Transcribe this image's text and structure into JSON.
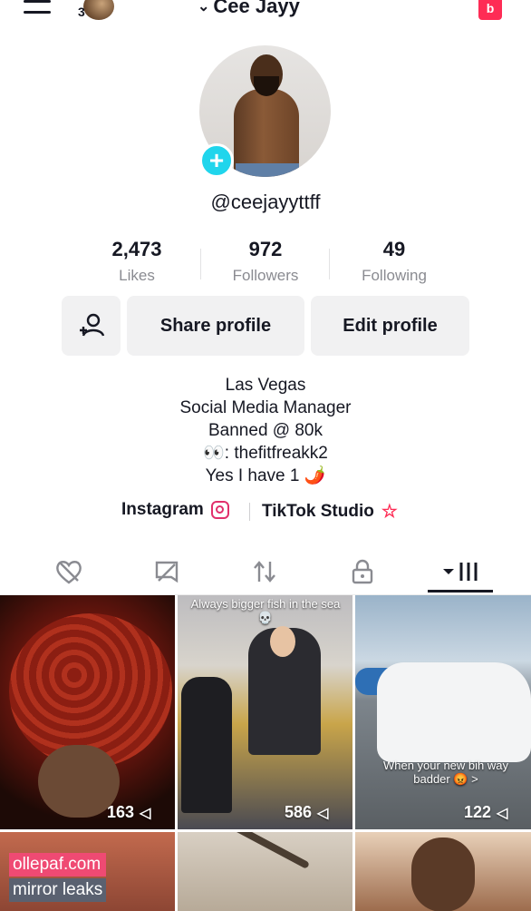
{
  "header": {
    "username": "Cee Jayy",
    "friends_count": "3",
    "inbox_badge": "b"
  },
  "profile": {
    "handle": "@ceejayyttff",
    "stats": [
      {
        "value": "49",
        "label": "Following"
      },
      {
        "value": "972",
        "label": "Followers"
      },
      {
        "value": "2,473",
        "label": "Likes"
      }
    ]
  },
  "actions": {
    "edit_label": "Edit profile",
    "share_label": "Share profile"
  },
  "bio": {
    "lines": [
      "Las Vegas",
      "Social Media Manager",
      "Banned @ 80k",
      "👀: thefitfreakk2",
      "Yes I have 1 🌶️"
    ]
  },
  "links": {
    "instagram_label": "Instagram",
    "studio_label": "TikTok Studio"
  },
  "tabs": [
    {
      "name": "videos",
      "icon": "grid-icon",
      "active": true
    },
    {
      "name": "private",
      "icon": "lock-icon",
      "active": false
    },
    {
      "name": "reposts",
      "icon": "repost-icon",
      "active": false
    },
    {
      "name": "saved",
      "icon": "bookmark-icon",
      "active": false
    },
    {
      "name": "liked",
      "icon": "heart-icon",
      "active": false
    }
  ],
  "videos": [
    {
      "views": "163",
      "caption": ""
    },
    {
      "views": "586",
      "caption": "Always bigger fish in the sea 💀"
    },
    {
      "views": "122",
      "caption": "When your new bih way badder 😡 >"
    },
    {
      "views": "",
      "caption": ""
    },
    {
      "views": "",
      "caption": ""
    },
    {
      "views": "",
      "caption": ""
    }
  ],
  "watermark": {
    "line1": "ollepaf.com",
    "line2": "mirror leaks"
  },
  "colors": {
    "accent": "#fe2c55",
    "add_badge": "#20d5ec",
    "button_bg": "#f1f1f2",
    "secondary_text": "#8a8b91"
  }
}
